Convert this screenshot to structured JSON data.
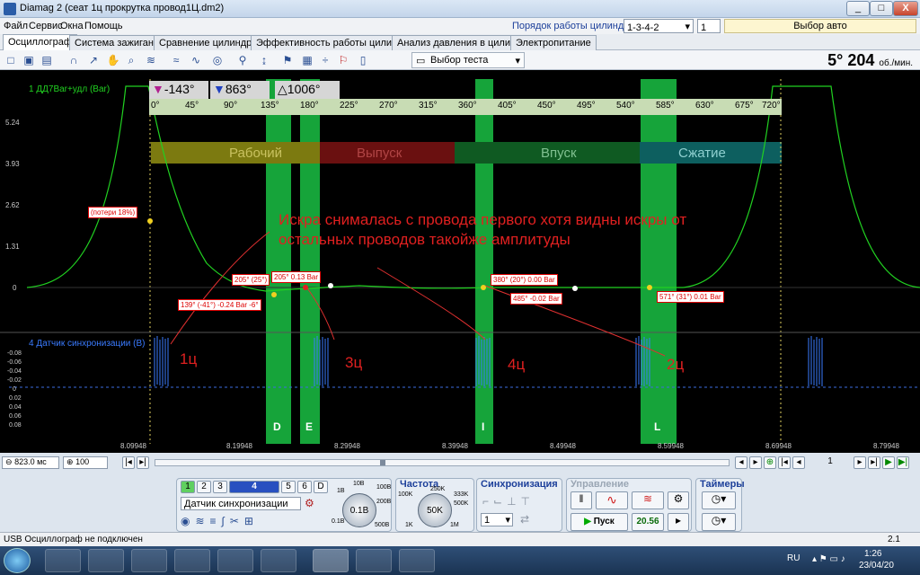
{
  "window": {
    "title": "Diamag 2 (сеат 1ц прокрутка провод1Ц.dm2)",
    "min": "_",
    "max": "□",
    "close": "X"
  },
  "menu": [
    "Файл",
    "Сервис",
    "Окна",
    "Помощь"
  ],
  "cylinders": {
    "label": "Порядок работы цилиндров",
    "order": "1-3-4-2",
    "num": "1",
    "auto": "Выбор авто"
  },
  "tabs": [
    "Осциллограф",
    "Система зажигания",
    "Сравнение цилиндров",
    "Эффективность работы цилиндров",
    "Анализ давления в цилиндре",
    "Электропитание"
  ],
  "toolbar": {
    "test_select": "Выбор теста"
  },
  "rpm": {
    "value": "5° 204",
    "unit": "об./мин."
  },
  "channel1": {
    "label": "1 ДД7Bar+удл (Bar)",
    "yticks": [
      "5.24",
      "3.93",
      "2.62",
      "1.31",
      "0"
    ]
  },
  "channel4": {
    "label": "4 Датчик синхронизации (В)",
    "yticks": [
      "-0.08",
      "-0.06",
      "-0.04",
      "-0.02",
      "0",
      "0.02",
      "0.04",
      "0.06",
      "0.08"
    ]
  },
  "markers": {
    "m1": "-143°",
    "m2": "863°",
    "delta": "1006°"
  },
  "degrees": [
    "0°",
    "45°",
    "90°",
    "135°",
    "180°",
    "225°",
    "270°",
    "315°",
    "360°",
    "405°",
    "450°",
    "495°",
    "540°",
    "585°",
    "630°",
    "675°",
    "720°"
  ],
  "phases": [
    "Рабочий",
    "Выпуск",
    "Впуск",
    "Сжатие"
  ],
  "annotations": {
    "loss": "(потери 18%)",
    "p1": "139° (-41°) -0.24 Bar -6°",
    "p2": "205° (25°) ",
    "p3": "205° 0.13 Bar",
    "p4": "380° (20°) 0.00 Bar",
    "p5": "485° -0.02 Bar",
    "p6": "571° (31°) 0.01 Bar",
    "note": "Искра снималась с провода первого хотя видны искры от остальных проводов такойже амплитуды"
  },
  "cyl_labels": [
    "1ц",
    "3ц",
    "4ц",
    "2ц"
  ],
  "valve_letters": [
    "D",
    "E",
    "I",
    "L"
  ],
  "time_ticks": [
    "8.09948",
    "8.19948",
    "8.29948",
    "8.39948",
    "8.49948",
    "8.59948",
    "8.69948",
    "8.79948"
  ],
  "bottom": {
    "timebase": "823.0 мс",
    "zoom": "100",
    "page": "1",
    "channels": [
      "1",
      "2",
      "3",
      "4",
      "5",
      "6",
      "D"
    ],
    "sensor": "Датчик синхронизации",
    "knob_value": "0.1В",
    "knob_ticks": [
      "10В",
      "100В",
      "200В",
      "500В",
      "0.1В",
      "1В"
    ],
    "freq_title": "Частота",
    "freq_value": "50K",
    "freq_ticks": [
      "100K",
      "250K",
      "333K",
      "500K",
      "1K",
      "1M"
    ],
    "sync_title": "Синхронизация",
    "sync_value": "1",
    "ctrl_title": "Управление",
    "start": "Пуск",
    "rate": "20.56",
    "timers_title": "Таймеры"
  },
  "status": {
    "left": "USB Осциллограф не подключен",
    "right": "2.1"
  },
  "taskbar": {
    "lang": "RU",
    "time": "1:26",
    "date": "23/04/20"
  }
}
